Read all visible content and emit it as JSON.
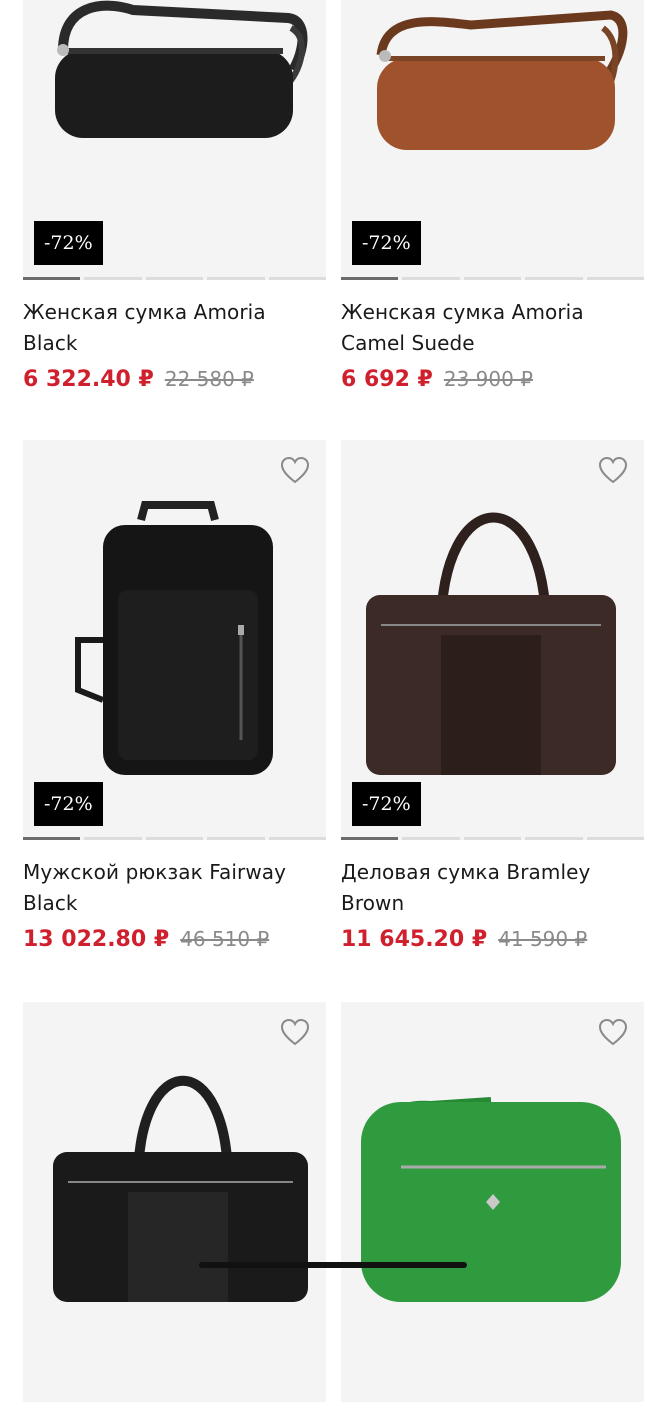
{
  "products": [
    {
      "title": "Женская сумка Amoria Black",
      "price": "6 322.40 ₽",
      "old_price": "22 580 ₽",
      "discount": "-72%",
      "color": "#1c1c1c"
    },
    {
      "title": "Женская сумка Amoria Camel Suede",
      "price": "6 692 ₽",
      "old_price": "23 900 ₽",
      "discount": "-72%",
      "color": "#a0522d"
    },
    {
      "title": "Мужской рюкзак Fairway Black",
      "price": "13 022.80 ₽",
      "old_price": "46 510 ₽",
      "discount": "-72%",
      "color": "#151515"
    },
    {
      "title": "Деловая сумка Bramley Brown",
      "price": "11 645.20 ₽",
      "old_price": "41 590 ₽",
      "discount": "-72%",
      "color": "#3b2a26"
    },
    {
      "title": "",
      "price": "",
      "old_price": "",
      "discount": "",
      "color": "#1a1a1a"
    },
    {
      "title": "",
      "price": "",
      "old_price": "",
      "discount": "",
      "color": "#2f9a3e"
    }
  ],
  "icons": {
    "wishlist": "heart-outline-icon"
  },
  "colors": {
    "price": "#d0202e",
    "badge_bg": "#000000",
    "card_bg": "#f4f4f4"
  }
}
